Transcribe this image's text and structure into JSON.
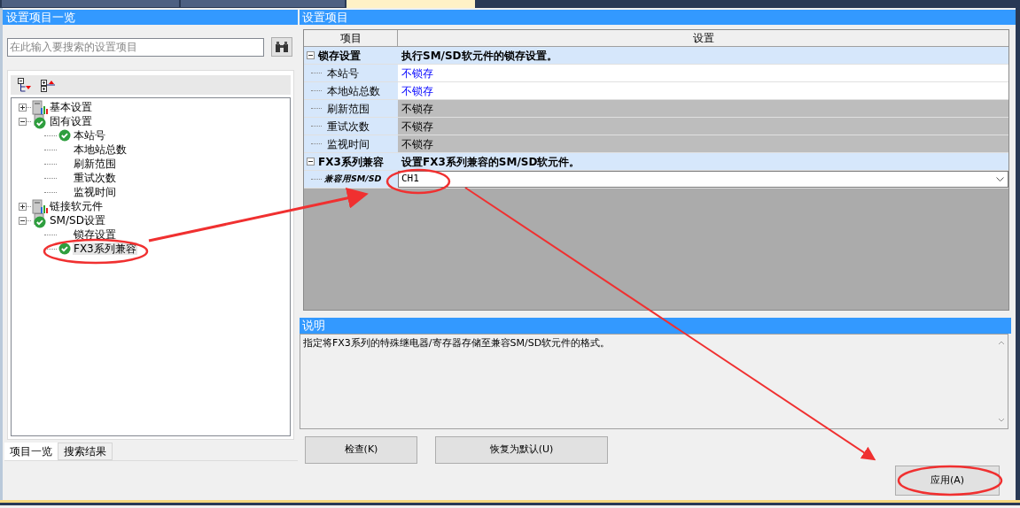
{
  "document_tabs": [
    {
      "selected": false
    },
    {
      "selected": false
    },
    {
      "selected": true
    }
  ],
  "left_panel": {
    "title": "设置项目一览",
    "search": {
      "placeholder": "在此输入要搜索的设置项目"
    },
    "tree": [
      {
        "label": "基本设置",
        "kind": "pc",
        "expanded": false,
        "selected": false
      },
      {
        "label": "固有设置",
        "kind": "pc-check",
        "expanded": true,
        "selected": false,
        "children": [
          {
            "label": "本站号",
            "kind": "check",
            "selected": false
          },
          {
            "label": "本地站总数",
            "selected": false
          },
          {
            "label": "刷新范围",
            "selected": false
          },
          {
            "label": "重试次数",
            "selected": false
          },
          {
            "label": "监视时间",
            "selected": false
          }
        ]
      },
      {
        "label": "链接软元件",
        "kind": "pc",
        "expanded": false,
        "selected": false
      },
      {
        "label": "SM/SD设置",
        "kind": "pc-check",
        "expanded": true,
        "selected": false,
        "children": [
          {
            "label": "锁存设置",
            "selected": false
          },
          {
            "label": "FX3系列兼容",
            "kind": "check",
            "selected": true
          }
        ]
      }
    ],
    "tabs": [
      {
        "label": "项目一览",
        "selected": true
      },
      {
        "label": "搜索结果",
        "selected": false
      }
    ]
  },
  "settings_panel": {
    "title": "设置项目",
    "columns": [
      "项目",
      "设置"
    ],
    "rows": [
      {
        "kind": "group",
        "expanded": true,
        "label": "锁存设置",
        "value": "执行SM/SD软元件的锁存设置。"
      },
      {
        "kind": "item",
        "label": "本站号",
        "value": "不锁存",
        "disabled": false
      },
      {
        "kind": "item",
        "label": "本地站总数",
        "value": "不锁存",
        "disabled": false
      },
      {
        "kind": "item",
        "label": "刷新范围",
        "value": "不锁存",
        "disabled": true
      },
      {
        "kind": "item",
        "label": "重试次数",
        "value": "不锁存",
        "disabled": true
      },
      {
        "kind": "item",
        "label": "监视时间",
        "value": "不锁存",
        "disabled": true
      },
      {
        "kind": "group",
        "expanded": true,
        "label": "FX3系列兼容",
        "value": "设置FX3系列兼容的SM/SD软元件。"
      },
      {
        "kind": "combo",
        "label": "兼容用SM/SD",
        "value": "CH1"
      }
    ]
  },
  "description": {
    "title": "说明",
    "text": "指定将FX3系列的特殊继电器/寄存器存储至兼容SM/SD软元件的格式。"
  },
  "buttons": [
    {
      "label": "检查(K)"
    },
    {
      "label": "恢复为默认(U)"
    },
    {
      "label": "应用(A)"
    }
  ]
}
